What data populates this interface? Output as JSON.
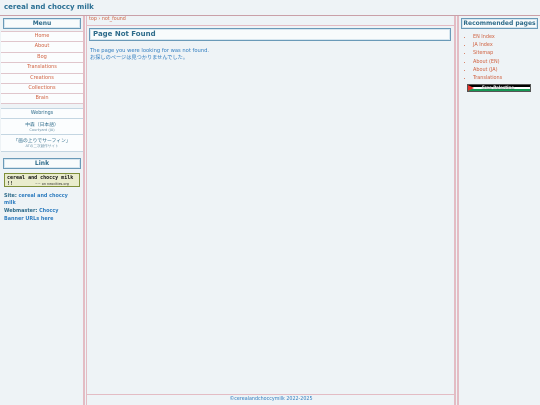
{
  "site": {
    "title": "cereal and choccy milk"
  },
  "left": {
    "menu_title": "Menu",
    "menu_items": [
      "Home",
      "About",
      "Bog",
      "Translations",
      "Creations",
      "Collections",
      "Brain"
    ],
    "sub_items": [
      {
        "label": "Webrings",
        "note": ""
      },
      {
        "label": "中森（日本語）",
        "note": "Courtyard (JA)"
      },
      {
        "label": "「画の上りでサーフィン」",
        "note": "ATの二次創作サイト"
      }
    ],
    "link_title": "Link",
    "banner": {
      "text1": "cereal and choccy milk !!",
      "text2": "~~ on neocities.org"
    },
    "info": {
      "site_label": "Site:",
      "site_value": "cereal and choccy milk",
      "webmaster_label": "Webmaster:",
      "webmaster_value": "Choccy",
      "banner_urls": "Banner URLs here"
    }
  },
  "main": {
    "breadcrumb": "top › not_found",
    "title": "Page Not Found",
    "message_en": "The page you were looking for was not found.",
    "message_ja": "お探しのページは見つかりませんでした。",
    "footer": "©cerealandchoccymilk 2022-2025"
  },
  "right": {
    "title": "Recommended pages",
    "items": [
      "EN Index",
      "JA Index",
      "Sitemap",
      "About (EN)",
      "About (JA)",
      "Translations"
    ],
    "flag_banner_text": "Free Palestine"
  }
}
